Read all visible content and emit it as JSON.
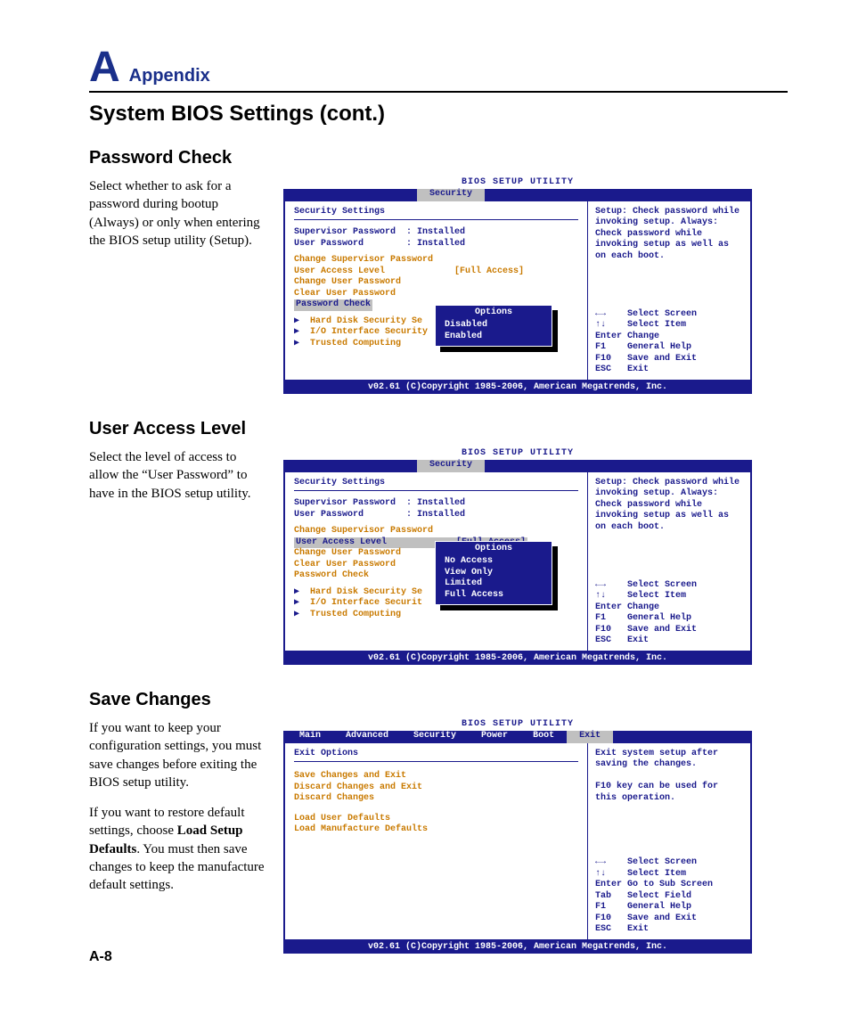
{
  "header": {
    "big": "A",
    "label": "Appendix"
  },
  "title": "System BIOS Settings (cont.)",
  "page_num": "A-8",
  "bios_common": {
    "title": "BIOS SETUP UTILITY",
    "footer": "v02.61 (C)Copyright 1985-2006, American Megatrends, Inc.",
    "nav_security": "←→    Select Screen\n↑↓    Select Item\nEnter Change\nF1    General Help\nF10   Save and Exit\nESC   Exit",
    "nav_exit": "←→    Select Screen\n↑↓    Select Item\nEnter Go to Sub Screen\nTab   Select Field\nF1    General Help\nF10   Save and Exit\nESC   Exit",
    "help_sec": "Setup: Check password while invoking setup. Always: Check password while invoking setup as well as on each boot.",
    "help_exit": "Exit system setup after saving the changes.\n\nF10 key can be used for this operation."
  },
  "tabs_sec": [
    "Security"
  ],
  "tabs_exit": {
    "items": [
      "Main",
      "Advanced",
      "Security",
      "Power",
      "Boot",
      "Exit"
    ],
    "selected": "Exit"
  },
  "sec1": {
    "title": "Password Check",
    "body": "Select whether to ask for a password during bootup (Always) or only when entering the BIOS setup utility (Setup).",
    "panel_header": "Security Settings",
    "rows": {
      "r1": "Supervisor Password  : Installed",
      "r2": "User Password        : Installed",
      "r3": "Change Supervisor Password",
      "r4a": "User Access Level",
      "r4b": "[Full Access]",
      "r5": "Change User Password",
      "r6": "Clear User Password",
      "r7": "Password Check",
      "sub1": "Hard Disk Security Se",
      "sub2": "I/O Interface Security",
      "sub3": "Trusted Computing"
    },
    "popup": {
      "title": "Options",
      "opts": [
        "Disabled",
        "Enabled"
      ]
    }
  },
  "sec2": {
    "title": "User Access Level",
    "body": "Select the level of access to allow the “User Pass­word” to have in the BIOS setup utility.",
    "panel_header": "Security Settings",
    "rows": {
      "r1": "Supervisor Password  : Installed",
      "r2": "User Password        : Installed",
      "r3": "Change Supervisor Password",
      "r4a": "User Access Level",
      "r4b": "[Full Access]",
      "r5": "Change User Password",
      "r6": "Clear User Password",
      "r7": "Password Check",
      "sub1": "Hard Disk Security Se",
      "sub2": "I/O Interface Securit",
      "sub3": "Trusted Computing"
    },
    "popup": {
      "title": "Options",
      "opts": [
        "No Access",
        "View Only",
        "Limited",
        "Full Access"
      ]
    }
  },
  "sec3": {
    "title": "Save Changes",
    "body1": "If you want to keep your configuration settings, you must save changes before exiting the BIOS setup utility.",
    "body2a": "If you want to restore default settings, choose ",
    "body2b": "Load Setup Defaults",
    "body2c": ". You must then save changes to keep the manufacture default settings.",
    "panel_header": "Exit Options",
    "rows": {
      "r1": "Save Changes and Exit",
      "r2": "Discard Changes and Exit",
      "r3": "Discard Changes",
      "r4": "Load User Defaults",
      "r5": "Load Manufacture Defaults"
    }
  }
}
